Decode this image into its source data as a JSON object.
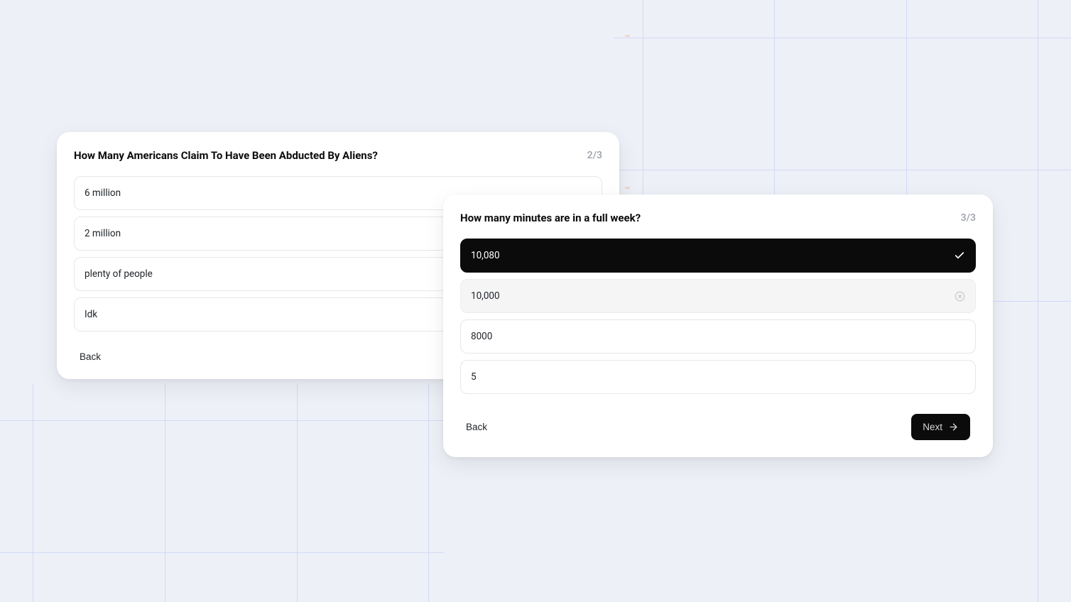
{
  "card1": {
    "title": "How Many Americans Claim To Have Been Abducted By Aliens?",
    "counter": "2/3",
    "options": [
      {
        "label": "6 million"
      },
      {
        "label": "2 million"
      },
      {
        "label": "plenty of people"
      },
      {
        "label": "Idk"
      }
    ],
    "back": "Back"
  },
  "card2": {
    "title": "How many minutes are in a full week?",
    "counter": "3/3",
    "options": [
      {
        "label": "10,080",
        "state": "selected"
      },
      {
        "label": "10,000",
        "state": "muted"
      },
      {
        "label": "8000"
      },
      {
        "label": "5"
      }
    ],
    "back": "Back",
    "next": "Next"
  },
  "icons": {
    "check": "check-icon",
    "close_circle": "close-circle-icon",
    "arrow_right": "arrow-right-icon"
  }
}
